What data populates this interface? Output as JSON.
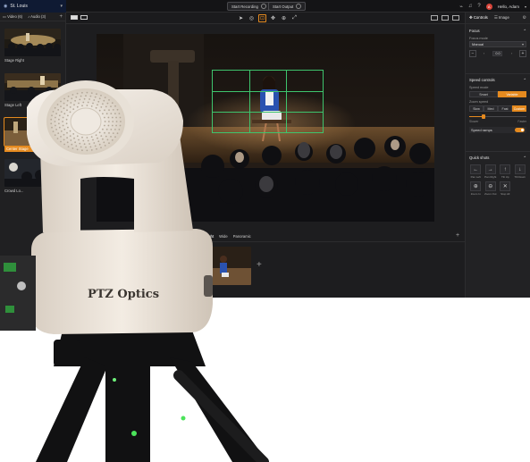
{
  "colors": {
    "accent": "#e58a1f",
    "grid": "#3ec46d",
    "app_bg": "#1d1d1f"
  },
  "topbar": {
    "project_name": "St. Louis",
    "start_recording": "Start Recording",
    "start_output": "Start Output",
    "greeting": "Hello, Adam",
    "avatar_initial": "A",
    "icons": [
      "analytics-icon",
      "bell-icon",
      "help-icon"
    ]
  },
  "left_panel": {
    "tabs": [
      "Video (6)",
      "Audio (3)"
    ],
    "shots": [
      {
        "label": "Stage Right",
        "active": false
      },
      {
        "label": "Stage Left",
        "active": false
      },
      {
        "label": "Center Stage",
        "active": true
      },
      {
        "label": "Crowd Lo...",
        "active": false
      }
    ]
  },
  "bottom": {
    "tabs": [
      "Tight",
      "Wide",
      "Panoramic"
    ],
    "active_tab": "Tight"
  },
  "right_panel": {
    "tabs": [
      "Controls",
      "Image"
    ],
    "active_tab": "Controls",
    "focus": {
      "title": "Focus",
      "mode_label": "Focus mode",
      "mode_value": "Manual",
      "value": "0.0"
    },
    "speed": {
      "title": "Speed controls",
      "mode_label": "Speed mode",
      "modes": [
        "Smart",
        "Variable"
      ],
      "active_mode": "Variable",
      "zoom_label": "Zoom speed",
      "zoom_options": [
        "Slow",
        "Med",
        "Fast",
        "Custom"
      ],
      "active_zoom": "Custom",
      "zoom_level": 0.25,
      "slider_min_label": "Slower",
      "slider_max_label": "Faster",
      "ramps_label": "Speed ramps",
      "ramps_on": true
    },
    "quick_shots": {
      "title": "Quick shots",
      "items": [
        {
          "icon": "arrow-left-icon",
          "glyph": "←",
          "label": "Pan Left"
        },
        {
          "icon": "arrow-right-icon",
          "glyph": "→",
          "label": "Pan Right"
        },
        {
          "icon": "arrow-up-icon",
          "glyph": "↑",
          "label": "Tilt Up"
        },
        {
          "icon": "arrow-down-icon",
          "glyph": "↓",
          "label": "Tilt Down"
        },
        {
          "icon": "zoom-in-icon",
          "glyph": "⊕",
          "label": "Zoom In"
        },
        {
          "icon": "zoom-out-icon",
          "glyph": "⊖",
          "label": "Zoom Out"
        },
        {
          "icon": "stop-icon",
          "glyph": "✕",
          "label": "Stop All"
        }
      ]
    }
  },
  "camera": {
    "brand": "PTZ Optics"
  }
}
